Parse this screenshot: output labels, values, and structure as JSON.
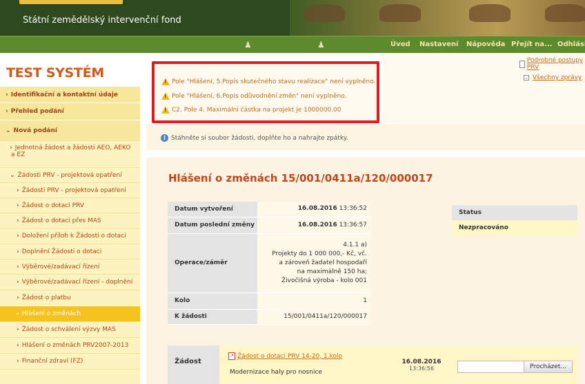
{
  "header": {
    "organization": "Státní zemědělský intervenční fond"
  },
  "nav": {
    "items": [
      "Úvod",
      "Nastavení",
      "Nápověda",
      "Přejít na...",
      "Odhlásit"
    ]
  },
  "sidebar": {
    "system_title": "TEST SYSTÉM",
    "sections": [
      "Identifikační a kontaktní údaje",
      "Přehled podání",
      "Nová podání"
    ],
    "items": [
      "Jednotná žádost a žádosti AEO, AEKO",
      "a EZ",
      "Žádosti PRV - projektová opatření",
      "Žádosti PRV - projektová opatření",
      "Žádost o dotaci PRV",
      "Žádost o dotaci přes MAS",
      "Doložení příloh k Žádosti o dotaci",
      "Doplnění Žádosti o dotaci",
      "Výběrové/zadávací řízení",
      "Výběrové/zadávací řízení - doplnění",
      "Žádost o platbu",
      "Hlášení o změnách",
      "Žádost o schválení výzvy MAS",
      "Hlášení o změnách PRV2007-2013",
      "Finanční zdraví (FZ)"
    ]
  },
  "messages": {
    "warnings": [
      "Pole \"Hlášení, 5.Popis skutečného stavu realizace\" není vyplněno.",
      "Pole \"Hlášení, 6.Popis odůvodnění změn\" není vyplněno.",
      "C2. Pole 4. Maximální částka na projekt je 1000000.00"
    ],
    "procedures_link": "Podrobné postupy PRV",
    "all_messages_link": "Všechny zprávy",
    "info": "Stáhněte si soubor žádosti, doplňte ho a nahrajte zpátky."
  },
  "detail": {
    "title": "Hlášení o změnách 15/001/0411a/120/000017",
    "rows": [
      {
        "label": "Datum vytvoření",
        "date": "16.08.2016",
        "time": "13:36:52"
      },
      {
        "label": "Datum poslední změny",
        "date": "16.08.2016",
        "time": "13:36:57"
      }
    ],
    "operation_label": "Operace/záměr",
    "operation_lines": [
      "4.1.1 a)",
      "Projekty do 1 000 000,- Kč, vč.",
      "a zároveň žadatel hospodaří",
      "na maximálně 150 ha;",
      "Živočišná výroba - kolo 001"
    ],
    "round_label": "Kolo",
    "round_value": "1",
    "request_label": "K žádosti",
    "request_value": "15/001/0411a/120/000017",
    "status_label": "Status",
    "status_value": "Nezpracováno"
  },
  "attachment": {
    "label": "Žádost",
    "link": "Žádost o dotaci PRV 14-20, 1.kolo",
    "description": "Modernizace haly pro nosnice",
    "date": "16.08.2016",
    "time": "13:36:56",
    "browse_label": "Procházet..."
  }
}
